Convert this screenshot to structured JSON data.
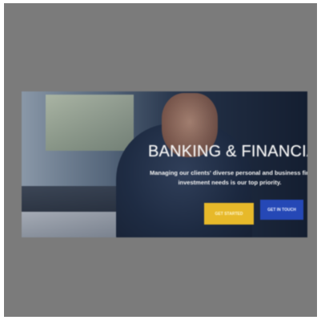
{
  "hero": {
    "headline_main": "BANKING",
    "headline_amp": " & ",
    "headline_rest": "FINANCIAL SER",
    "subline_1": "Managing our clients' diverse personal and business financial",
    "subline_2": "investment needs is our top priority.",
    "primary_button": "GET STARTED",
    "secondary_button": "GET IN TOUCH"
  },
  "colors": {
    "frame": "#7b7b7b",
    "primary_button": "#e7b92a",
    "secondary_button": "#2548b6",
    "headline_text": "#f2f2f2"
  }
}
